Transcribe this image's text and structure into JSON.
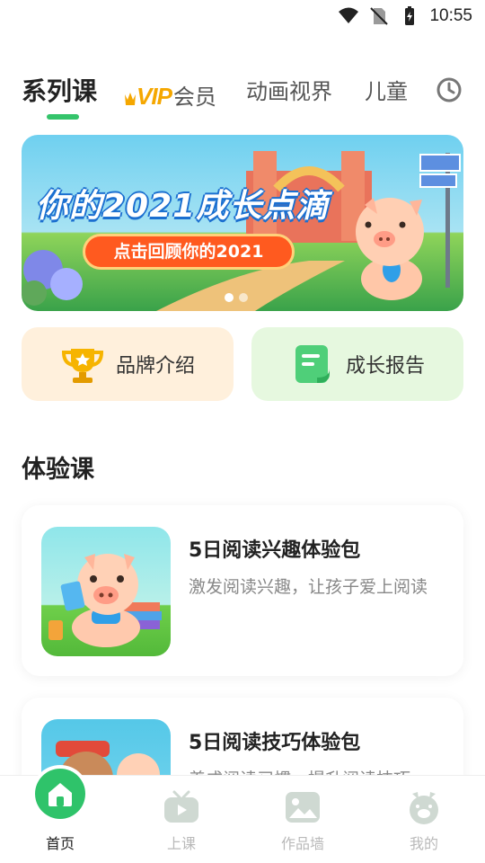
{
  "status_bar": {
    "time": "10:55"
  },
  "tabs": {
    "items": [
      "系列课",
      "会员",
      "动画视界",
      "儿童"
    ],
    "vip_label": "VIP"
  },
  "banner": {
    "title": "你的2021成长点滴",
    "cta": "点击回顾你的2021"
  },
  "quick_actions": [
    {
      "label": "品牌介绍",
      "icon": "trophy-icon"
    },
    {
      "label": "成长报告",
      "icon": "report-icon"
    }
  ],
  "section": {
    "title": "体验课"
  },
  "courses": [
    {
      "title": "5日阅读兴趣体验包",
      "subtitle": "激发阅读兴趣，让孩子爱上阅读"
    },
    {
      "title": "5日阅读技巧体验包",
      "subtitle": "养成阅读习惯，提升阅读技巧"
    }
  ],
  "bottom_nav": [
    {
      "label": "首页",
      "icon": "home-icon",
      "active": true
    },
    {
      "label": "上课",
      "icon": "tv-icon",
      "active": false
    },
    {
      "label": "作品墙",
      "icon": "gallery-icon",
      "active": false
    },
    {
      "label": "我的",
      "icon": "pig-face-icon",
      "active": false
    }
  ],
  "colors": {
    "accent": "#2fc36a",
    "vip": "#f5a700",
    "cta": "#ff5a1f"
  }
}
